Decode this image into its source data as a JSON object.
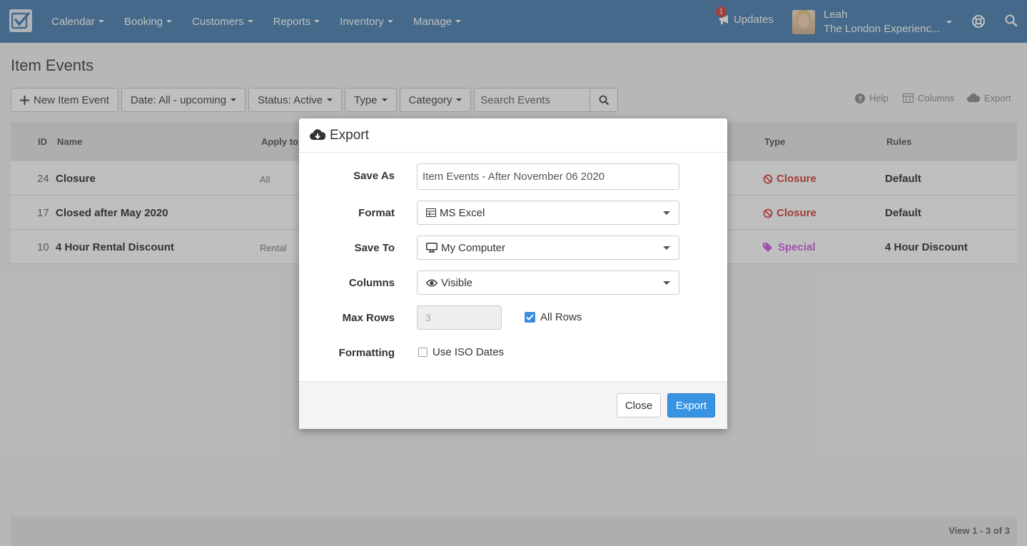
{
  "nav": {
    "menu": [
      {
        "label": "Calendar"
      },
      {
        "label": "Booking"
      },
      {
        "label": "Customers"
      },
      {
        "label": "Reports"
      },
      {
        "label": "Inventory"
      },
      {
        "label": "Manage"
      }
    ],
    "updates_label": "Updates",
    "updates_count": "1",
    "user_name": "Leah",
    "user_org": "The London Experienc..."
  },
  "page": {
    "title": "Item Events",
    "toolbar": {
      "new_label": "New Item Event",
      "date_filter": "Date: All - upcoming",
      "status_filter": "Status: Active",
      "type_filter": "Type",
      "category_filter": "Category",
      "search_placeholder": "Search Events"
    },
    "tools": {
      "help": "Help",
      "columns": "Columns",
      "export": "Export"
    },
    "table": {
      "headers": {
        "id": "ID",
        "name": "Name",
        "apply_to": "Apply to",
        "type": "Type",
        "rules": "Rules"
      },
      "rows": [
        {
          "id": "24",
          "name": "Closure",
          "apply_to": "All",
          "type": "Closure",
          "rules": "Default"
        },
        {
          "id": "17",
          "name": "Closed after May 2020",
          "apply_to": "",
          "type": "Closure",
          "rules": "Default"
        },
        {
          "id": "10",
          "name": "4 Hour Rental Discount",
          "apply_to": "Rental",
          "type": "Special",
          "rules": "4 Hour Discount"
        }
      ]
    },
    "pagination": "View 1 - 3 of 3"
  },
  "modal": {
    "title": "Export",
    "save_as_label": "Save As",
    "save_as_value": "Item Events - After November 06 2020",
    "format_label": "Format",
    "format_value": "MS Excel",
    "save_to_label": "Save To",
    "save_to_value": "My Computer",
    "columns_label": "Columns",
    "columns_value": "Visible",
    "max_rows_label": "Max Rows",
    "max_rows_value": "3",
    "all_rows_label": "All Rows",
    "all_rows_checked": true,
    "formatting_label": "Formatting",
    "iso_dates_label": "Use ISO Dates",
    "iso_dates_checked": false,
    "close_label": "Close",
    "export_label": "Export"
  },
  "colors": {
    "nav": "#5b8cb8",
    "primary": "#3993e3",
    "closure": "#d9534f",
    "special": "#d36ee3"
  },
  "icons": [
    "checkmark-logo-icon",
    "megaphone-icon",
    "lifebuoy-icon",
    "search-icon",
    "plus-icon",
    "question-icon",
    "columns-icon",
    "cloud-download-icon",
    "ban-icon",
    "tag-icon",
    "table-icon",
    "desktop-icon",
    "eye-icon",
    "check-icon"
  ]
}
